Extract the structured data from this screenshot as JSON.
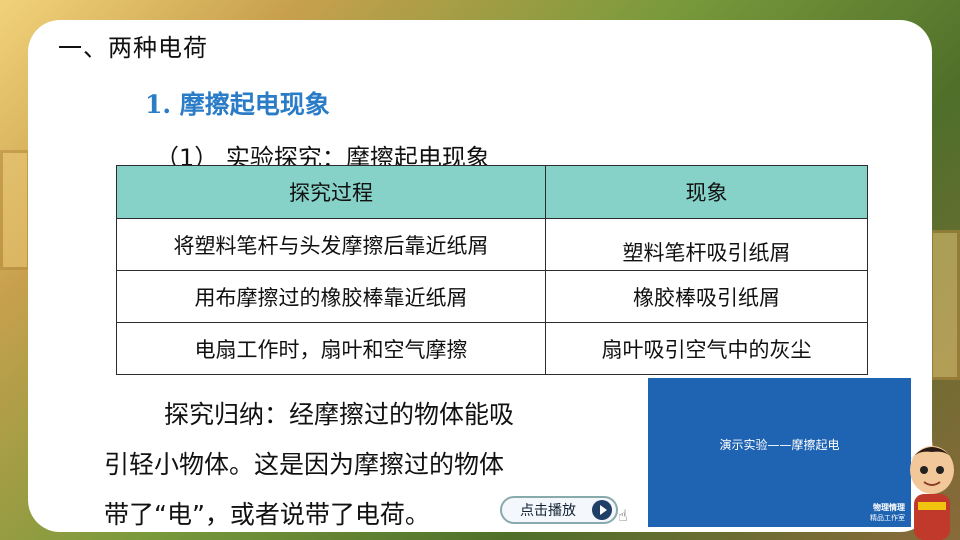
{
  "section": {
    "heading": "一、两种电荷",
    "subheading": "1. 摩擦起电现象",
    "experiment_title": "（1） 实验探究：摩擦起电现象"
  },
  "table": {
    "headers": [
      "探究过程",
      "现象"
    ],
    "rows": [
      [
        "将塑料笔杆与头发摩擦后靠近纸屑",
        "塑料笔杆吸引纸屑"
      ],
      [
        "用布摩擦过的橡胶棒靠近纸屑",
        "橡胶棒吸引纸屑"
      ],
      [
        "电扇工作时，扇叶和空气摩擦",
        "扇叶吸引空气中的灰尘"
      ]
    ]
  },
  "summary": {
    "line1": "探究归纳：经摩擦过的物体能吸",
    "line2": "引轻小物体。这是因为摩擦过的物体",
    "line3": "带了“电”，或者说带了电荷。"
  },
  "play_button": {
    "label": "点击播放"
  },
  "video": {
    "title": "演示实验——摩擦起电",
    "brand_line1": "物理情理",
    "brand_line2": "精品工作室"
  }
}
